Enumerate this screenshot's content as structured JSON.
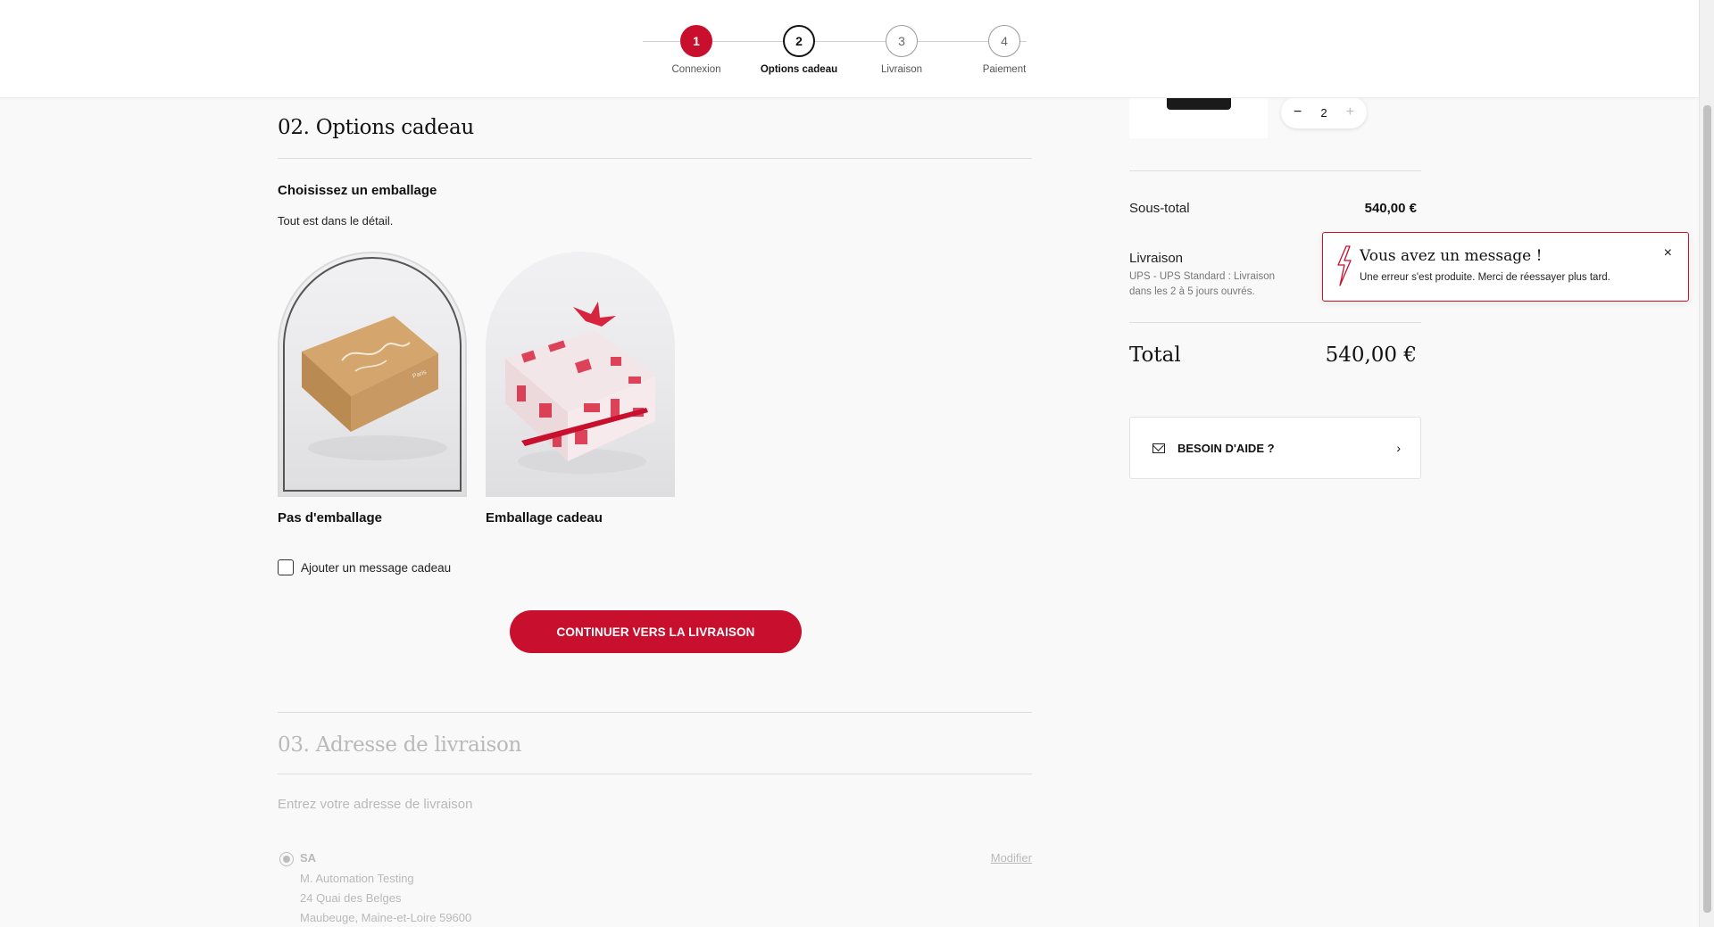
{
  "stepper": {
    "steps": [
      {
        "number": "1",
        "label": "Connexion",
        "state": "done"
      },
      {
        "number": "2",
        "label": "Options cadeau",
        "state": "active"
      },
      {
        "number": "3",
        "label": "Livraison",
        "state": "upcoming"
      },
      {
        "number": "4",
        "label": "Paiement",
        "state": "upcoming"
      }
    ]
  },
  "gift_section": {
    "title": "02. Options cadeau",
    "choose_title": "Choisissez un emballage",
    "choose_subtitle": "Tout est dans le détail.",
    "options": [
      {
        "name": "Pas d'emballage",
        "selected": true
      },
      {
        "name": "Emballage cadeau",
        "selected": false
      }
    ],
    "gift_message_label": "Ajouter un message cadeau",
    "gift_message_checked": false,
    "cta_label": "CONTINUER VERS LA LIVRAISON"
  },
  "address_section": {
    "title": "03. Adresse de livraison",
    "prompt": "Entrez votre adresse de livraison",
    "address": {
      "name": "SA",
      "lines": [
        "M. Automation Testing",
        "24 Quai des Belges",
        "Maubeuge, Maine-et-Loire 59600"
      ]
    },
    "modify_label": "Modifier"
  },
  "summary": {
    "quantity": "2",
    "subtotal_label": "Sous-total",
    "subtotal_value": "540,00 €",
    "shipping_label": "Livraison",
    "shipping_desc": "UPS - UPS Standard : Livraison dans les 2 à 5 jours ouvrés.",
    "total_label": "Total",
    "total_value": "540,00 €",
    "help_label": "BESOIN D'AIDE ?"
  },
  "toast": {
    "title": "Vous avez un message !",
    "body": "Une erreur s'est produite. Merci de réessayer plus tard.",
    "close": "×"
  },
  "colors": {
    "brand_red": "#c8102e",
    "background": "#f9f9f9",
    "muted_text": "#b9b9b9"
  }
}
